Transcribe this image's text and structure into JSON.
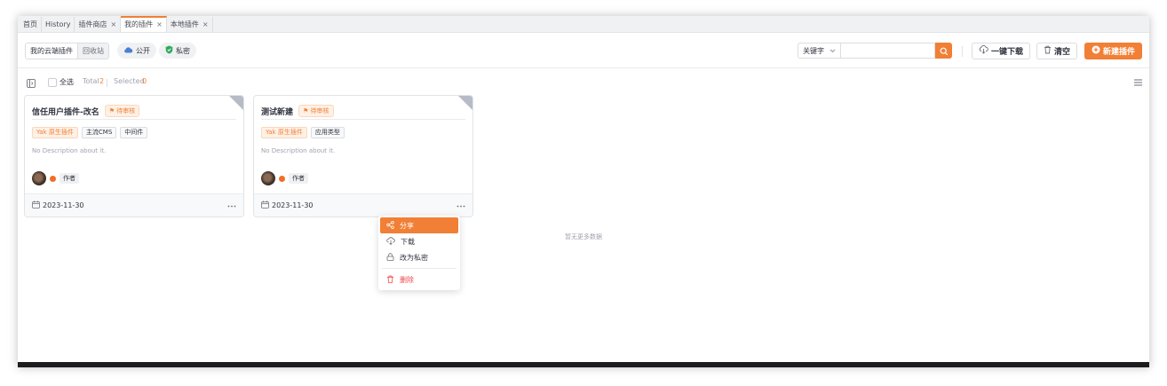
{
  "tabs": [
    {
      "label": "首页",
      "closable": false,
      "active": false
    },
    {
      "label": "History",
      "closable": false,
      "active": false
    },
    {
      "label": "插件商店",
      "closable": true,
      "active": false
    },
    {
      "label": "我的插件",
      "closable": true,
      "active": true
    },
    {
      "label": "本地插件",
      "closable": true,
      "active": false
    }
  ],
  "tab_close_glyph": "×",
  "toolbar": {
    "cloud_label": "我的云端插件",
    "recycle_label": "回收站",
    "public_label": "公开",
    "private_label": "私密",
    "keyword_select": "关键字",
    "search_value": "",
    "search_placeholder": "",
    "download_all_label": "一键下载",
    "clear_label": "清空",
    "new_plugin_label": "新建插件"
  },
  "subbar": {
    "select_all_label": "全选",
    "total_label": "Total",
    "total_value": "2",
    "selected_label": "Selected",
    "selected_value": "0"
  },
  "cards": [
    {
      "title": "信任用户插件-改名",
      "status": "待审核",
      "tags": [
        "Yak 原生插件",
        "主流CMS",
        "中间件"
      ],
      "description": "No Description about it.",
      "author_tag": "作者",
      "date": "2023-11-30"
    },
    {
      "title": "测试新建",
      "status": "待审核",
      "tags": [
        "Yak 原生插件",
        "应用类型"
      ],
      "description": "No Description about it.",
      "author_tag": "作者",
      "date": "2023-11-30"
    }
  ],
  "context_menu": {
    "share": "分享",
    "download": "下载",
    "make_private": "改为私密",
    "delete": "删除"
  },
  "no_more_text": "暂无更多数据",
  "colors": {
    "accent": "#f17f35",
    "danger": "#f0474b",
    "cloud": "#4a7fd8",
    "shield": "#2eaa5b"
  }
}
